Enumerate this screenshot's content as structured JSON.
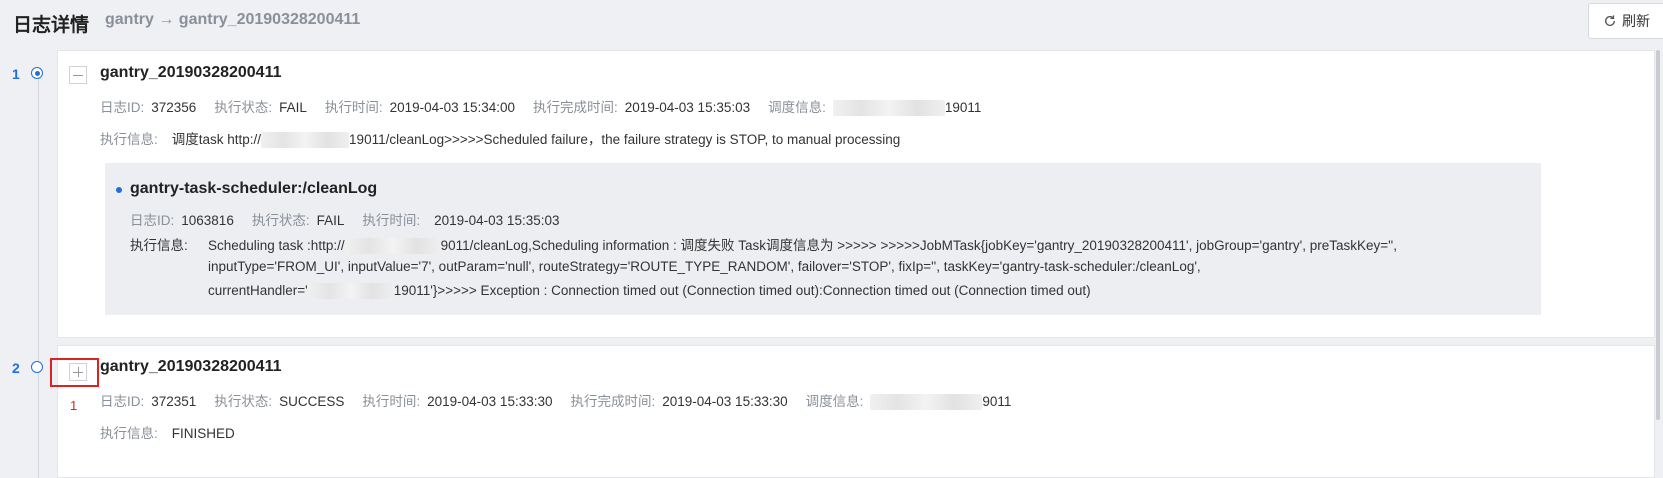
{
  "header": {
    "title": "日志详情",
    "breadcrumb": "gantry → gantry_20190328200411",
    "refresh_label": "刷新"
  },
  "timeline": [
    {
      "index": "1",
      "title": "gantry_20190328200411",
      "meta": {
        "log_id_label": "日志ID:",
        "log_id": "372356",
        "status_label": "执行状态:",
        "status": "FAIL",
        "exec_time_label": "执行时间:",
        "exec_time": "2019-04-03 15:34:00",
        "finish_time_label": "执行完成时间:",
        "finish_time": "2019-04-03 15:35:03",
        "dispatch_label": "调度信息:",
        "dispatch_suffix": "19011"
      },
      "info_label": "执行信息:",
      "info_prefix": "调度task http://",
      "info_suffix": "19011/cleanLog>>>>>Scheduled failure，the failure strategy is STOP, to manual processing",
      "sub": {
        "title": "gantry-task-scheduler:/cleanLog",
        "log_id_label": "日志ID:",
        "log_id": "1063816",
        "status_label": "执行状态:",
        "status": "FAIL",
        "exec_time_label": "执行时间:",
        "exec_time": "2019-04-03 15:35:03",
        "info_label": "执行信息:",
        "line1_prefix": "Scheduling task :http://",
        "line1_suffix": "9011/cleanLog,Scheduling information : 调度失败 Task调度信息为 >>>>> >>>>>JobMTask{jobKey='gantry_20190328200411', jobGroup='gantry', preTaskKey='',",
        "line2": "inputType='FROM_UI', inputValue='7', outParam='null', routeStrategy='ROUTE_TYPE_RANDOM', failover='STOP', fixIp='', taskKey='gantry-task-scheduler:/cleanLog',",
        "line3_prefix": "currentHandler='",
        "line3_suffix": "19011'}>>>>> Exception : Connection timed out (Connection timed out):Connection timed out (Connection timed out)"
      }
    },
    {
      "index": "2",
      "title": "gantry_20190328200411",
      "annotation": "1",
      "meta": {
        "log_id_label": "日志ID:",
        "log_id": "372351",
        "status_label": "执行状态:",
        "status": "SUCCESS",
        "exec_time_label": "执行时间:",
        "exec_time": "2019-04-03 15:33:30",
        "finish_time_label": "执行完成时间:",
        "finish_time": "2019-04-03 15:33:30",
        "dispatch_label": "调度信息:",
        "dispatch_suffix": "9011"
      },
      "info_label": "执行信息:",
      "info": "FINISHED"
    }
  ],
  "colors": {
    "accent": "#1e6fd9",
    "highlight": "#dd2222"
  }
}
